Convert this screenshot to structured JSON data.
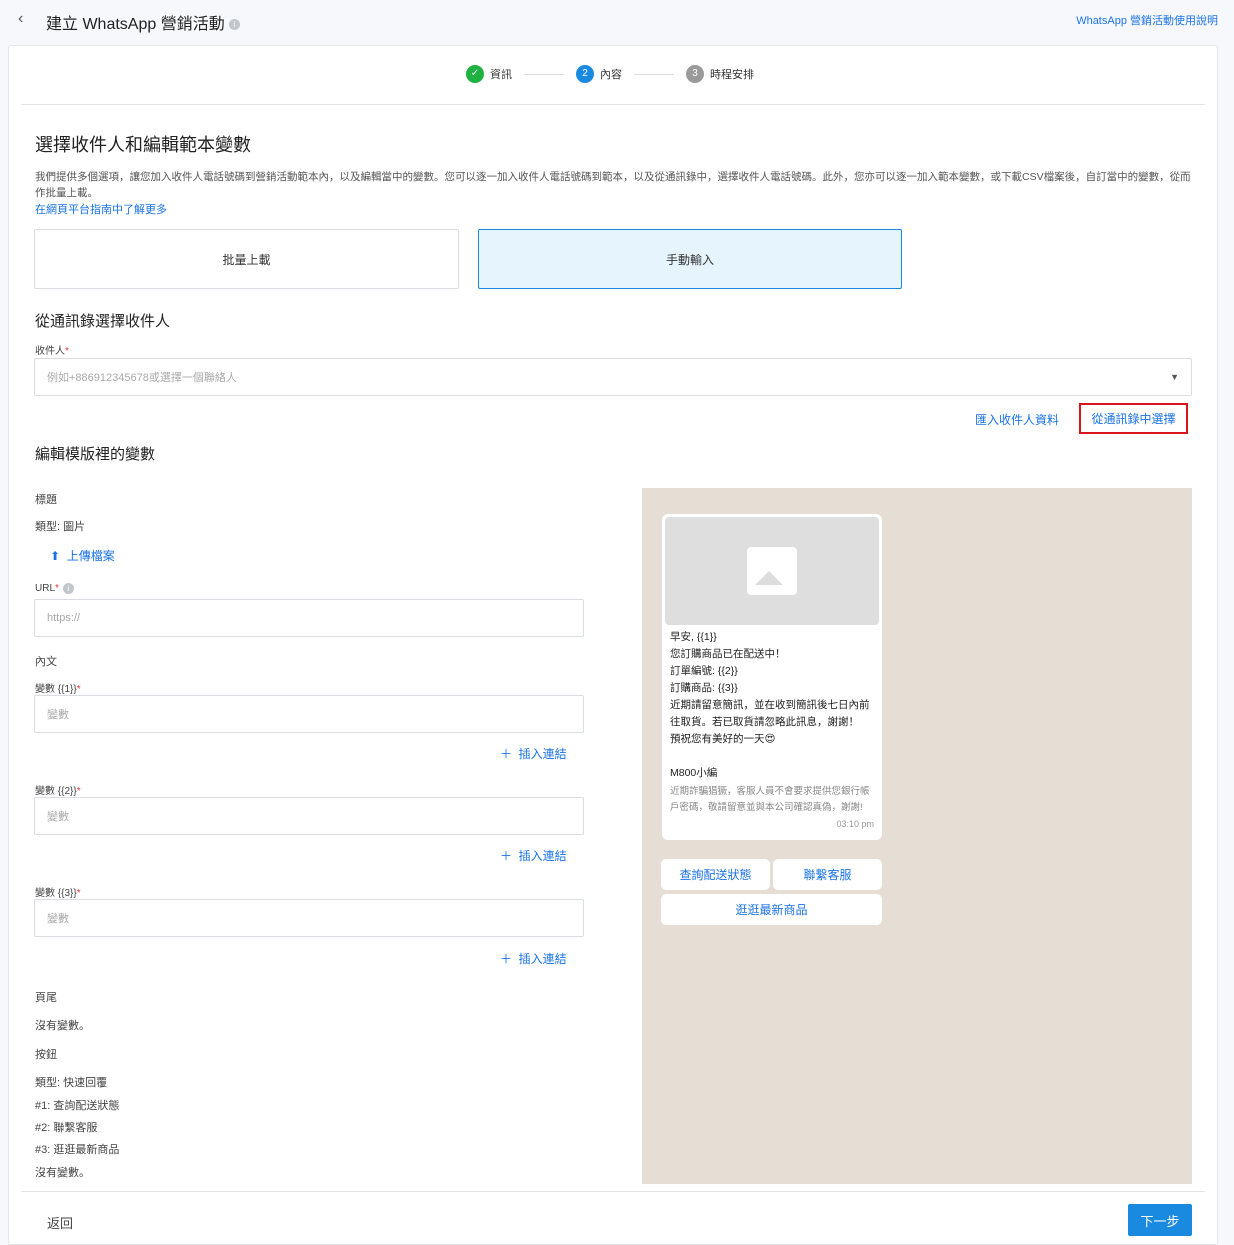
{
  "header": {
    "title": "建立 WhatsApp 營銷活動",
    "help_link": "WhatsApp 營銷活動使用說明"
  },
  "stepper": [
    {
      "label": "資訊",
      "num": ""
    },
    {
      "label": "內容",
      "num": "2"
    },
    {
      "label": "時程安排",
      "num": "3"
    }
  ],
  "section1": {
    "title": "選擇收件人和編輯範本變數",
    "description": "我們提供多個選項，讓您加入收件人電話號碼到營銷活動範本內，以及編輯當中的變數。您可以逐一加入收件人電話號碼到範本，以及從通訊錄中，選擇收件人電話號碼。此外，您亦可以逐一加入範本變數，或下載CSV檔案後，自訂當中的變數，從而作批量上載。",
    "learn_more": "在網頁平台指南中了解更多"
  },
  "tabs": {
    "bulk": "批量上載",
    "manual": "手動輸入"
  },
  "recipients": {
    "title": "從通訊錄選擇收件人",
    "label": "收件人",
    "placeholder": "例如+886912345678或選擇一個聯絡人",
    "import_link": "匯入收件人資料",
    "select_contacts": "從通訊錄中選擇"
  },
  "variables": {
    "title": "編輯模版裡的變數",
    "header_label": "標題",
    "header_type": "類型: 圖片",
    "upload": "上傳檔案",
    "url_label": "URL",
    "url_placeholder": "https://",
    "body_label": "內文",
    "fields": [
      {
        "label": "變數 {{1}}",
        "placeholder": "變數"
      },
      {
        "label": "變數 {{2}}",
        "placeholder": "變數"
      },
      {
        "label": "變數 {{3}}",
        "placeholder": "變數"
      }
    ],
    "insert_link": "插入連結",
    "footer_label": "頁尾",
    "footer_none": "沒有變數。",
    "buttons_label": "按鈕",
    "buttons_type": "類型: 快速回覆",
    "buttons": [
      "#1: 查詢配送狀態",
      "#2: 聯繫客服",
      "#3: 逛逛最新商品"
    ],
    "buttons_none": "沒有變數。"
  },
  "preview": {
    "lines": [
      "早安, {{1}}",
      "您訂購商品已在配送中！",
      "訂單編號: {{2}}",
      "訂購商品: {{3}}",
      "近期請留意簡訊，並在收到簡訊後七日內前往取貨。若已取貨請忽略此訊息，謝謝！",
      "預祝您有美好的一天😍"
    ],
    "signature": "M800小編",
    "footer": "近期詐騙猖獗，客服人員不會要求提供您銀行帳戶密碼，敬請留意並與本公司確認真偽，謝謝!",
    "time": "03:10 pm",
    "buttons": [
      "查詢配送狀態",
      "聯繫客服",
      "逛逛最新商品"
    ]
  },
  "footer": {
    "back": "返回",
    "next": "下一步"
  }
}
